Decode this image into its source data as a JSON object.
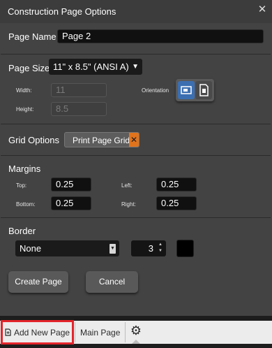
{
  "dialog": {
    "title": "Construction Page Options",
    "close_glyph": "✕"
  },
  "page_name": {
    "label": "Page Name",
    "value": "Page 2"
  },
  "page_size": {
    "label": "Page Size",
    "selected": "11\" x 8.5\" (ANSI A)",
    "width_label": "Width:",
    "width_value": "11",
    "height_label": "Height:",
    "height_value": "8.5",
    "orientation_label": "Orientation",
    "orientation_selected": "landscape"
  },
  "grid_options": {
    "label": "Grid Options",
    "chip_label": "Print Page Grid",
    "chip_remove": "✕"
  },
  "margins": {
    "label": "Margins",
    "top_label": "Top:",
    "top_value": "0.25",
    "left_label": "Left:",
    "left_value": "0.25",
    "bottom_label": "Bottom:",
    "bottom_value": "0.25",
    "right_label": "Right:",
    "right_value": "0.25"
  },
  "border": {
    "label": "Border",
    "style_selected": "None",
    "width_value": "3",
    "color": "#000000"
  },
  "buttons": {
    "create": "Create Page",
    "cancel": "Cancel"
  },
  "tabs": {
    "add_new_page": "Add New Page",
    "main_page": "Main Page"
  },
  "colors": {
    "accent_blue": "#3b6fb1",
    "chip_remove_orange": "#e0731c",
    "highlight_red": "#e3242b"
  }
}
